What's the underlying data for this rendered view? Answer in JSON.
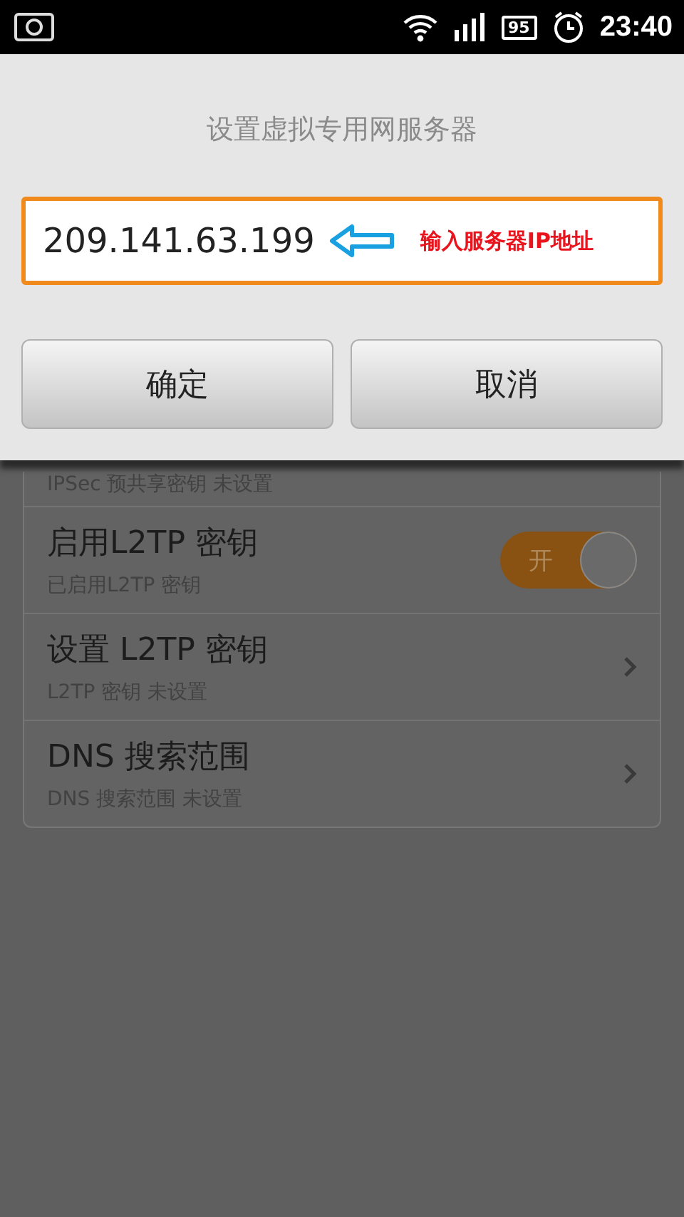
{
  "status_bar": {
    "battery": "95",
    "time": "23:40"
  },
  "dialog": {
    "title": "设置虚拟专用网服务器",
    "field": {
      "value": "209.141.63.199"
    },
    "annotation": {
      "text": "输入服务器IP地址"
    },
    "buttons": [
      "确定",
      "取消"
    ]
  },
  "settings": {
    "rows": [
      {
        "kind": "partial",
        "subtitle": "IPSec 预共享密钥 未设置"
      },
      {
        "kind": "toggle",
        "title": "启用L2TP 密钥",
        "subtitle": "已启用L2TP 密钥",
        "on": true,
        "toggle_label": "开"
      },
      {
        "kind": "link",
        "title": "设置 L2TP 密钥",
        "subtitle": "L2TP 密钥 未设置"
      },
      {
        "kind": "link",
        "title": "DNS 搜索范围",
        "subtitle": "DNS 搜索范围 未设置"
      }
    ]
  }
}
